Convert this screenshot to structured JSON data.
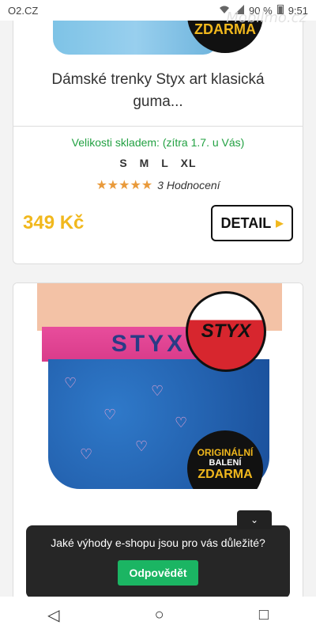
{
  "statusbar": {
    "carrier": "O2.CZ",
    "battery": "90 %",
    "time": "9:51"
  },
  "watermark": "Mobilmo.cz",
  "product1": {
    "badge_line1": "ZDARMA",
    "title": "Dámské trenky Styx art klasická guma...",
    "sizes_label": "Velikosti skladem: (zítra 1.7. u Vás)",
    "sizes": [
      "S",
      "M",
      "L",
      "XL"
    ],
    "stars": "★★★★★",
    "rating_text": "3 Hodnocení",
    "price": "349 Kč",
    "detail_label": "DETAIL",
    "detail_arrow": "▶"
  },
  "product2": {
    "brand": "STYX",
    "logo_text": "STYX",
    "badge_line1": "ORIGINÁLNÍ",
    "badge_line2": "BALENÍ",
    "badge_line3": "ZDARMA"
  },
  "popup": {
    "question": "Jaké výhody e-shopu jsou pro vás důležité?",
    "button_label": "Odpovědět",
    "toggle_icon": "⌄"
  },
  "navbar": {
    "back": "◁",
    "home": "○",
    "recents": "□"
  },
  "colors": {
    "green": "#22a142",
    "price": "#f1b81d",
    "popup_bg": "#262626",
    "button_green": "#1bb563"
  }
}
